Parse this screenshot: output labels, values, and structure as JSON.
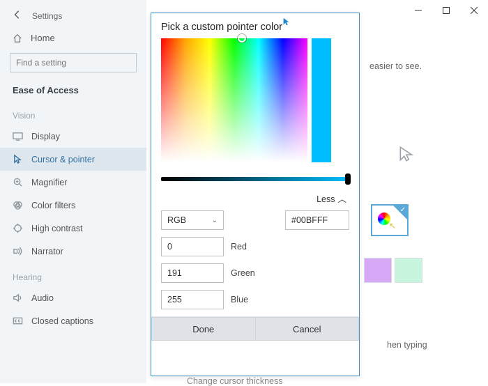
{
  "window": {
    "app_title": "Settings",
    "controls": {
      "min": "minimize",
      "max": "maximize",
      "close": "close"
    }
  },
  "sidebar": {
    "home_label": "Home",
    "search_placeholder": "Find a setting",
    "section": "Ease of Access",
    "groups": [
      {
        "label": "Vision",
        "items": [
          {
            "icon": "display-icon",
            "label": "Display"
          },
          {
            "icon": "cursor-icon",
            "label": "Cursor & pointer",
            "active": true
          },
          {
            "icon": "magnifier-icon",
            "label": "Magnifier"
          },
          {
            "icon": "color-filters-icon",
            "label": "Color filters"
          },
          {
            "icon": "high-contrast-icon",
            "label": "High contrast"
          },
          {
            "icon": "narrator-icon",
            "label": "Narrator"
          }
        ]
      },
      {
        "label": "Hearing",
        "items": [
          {
            "icon": "audio-icon",
            "label": "Audio"
          },
          {
            "icon": "closed-captions-icon",
            "label": "Closed captions"
          }
        ]
      }
    ]
  },
  "main": {
    "partial_text_1": "easier to see.",
    "partial_text_2": "hen typing",
    "thickness_label": "Change cursor thickness",
    "swatches": [
      "#d6a8f5",
      "#c7f5de"
    ]
  },
  "dialog": {
    "title": "Pick a custom pointer color",
    "less_label": "Less",
    "format_label": "RGB",
    "hex_value": "#00BFFF",
    "channels": [
      {
        "label": "Red",
        "value": "0"
      },
      {
        "label": "Green",
        "value": "191"
      },
      {
        "label": "Blue",
        "value": "255"
      }
    ],
    "done_label": "Done",
    "cancel_label": "Cancel",
    "selected_color": "#00BFFF"
  }
}
